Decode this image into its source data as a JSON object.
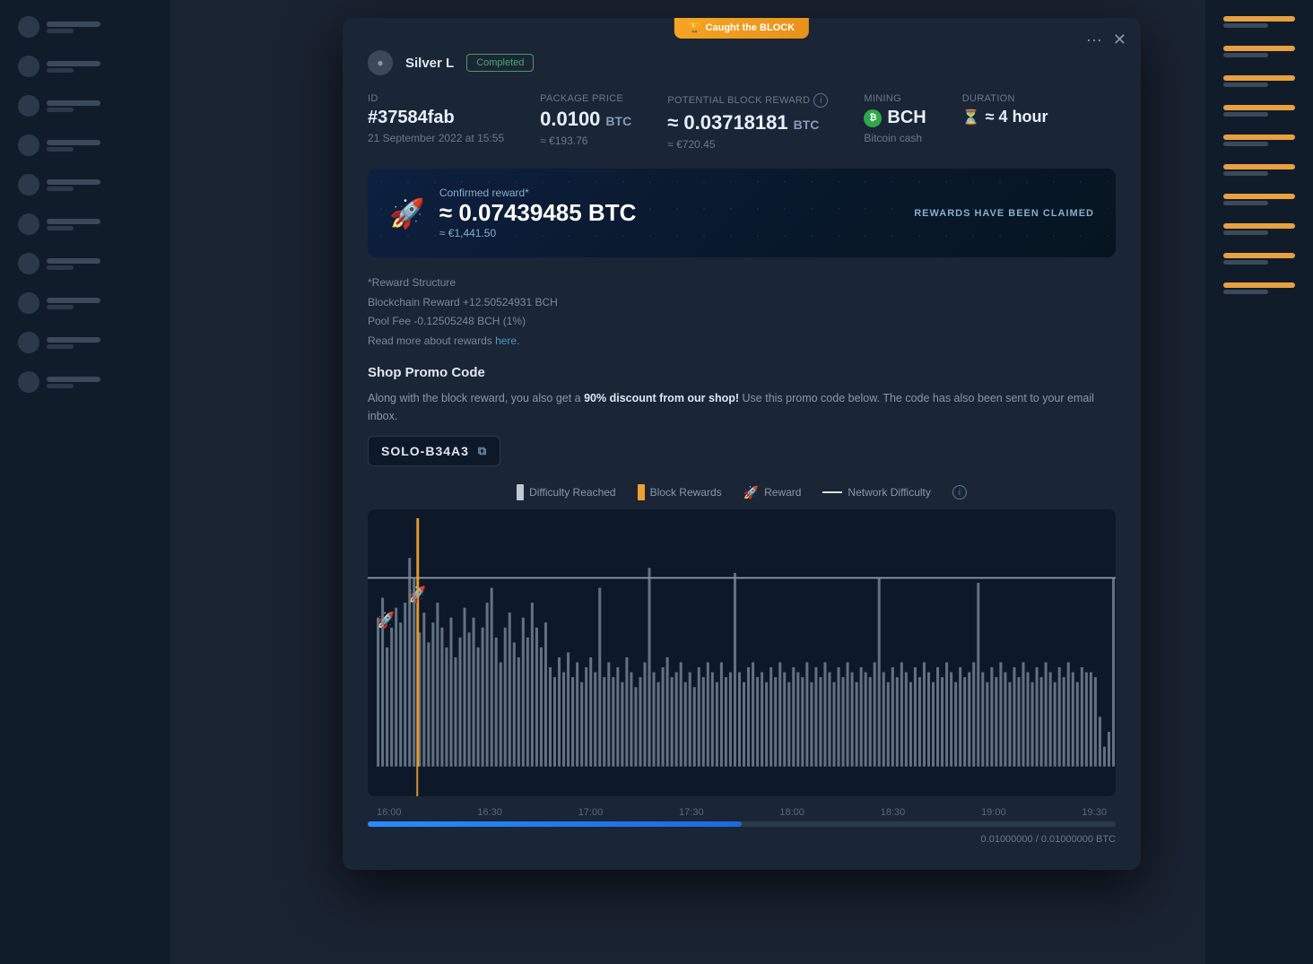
{
  "badge": {
    "icon": "🏆",
    "text": "Caught the BLOCK"
  },
  "modal": {
    "user": {
      "name": "Silver L",
      "status": "Completed"
    },
    "id_label": "ID",
    "id_value": "#37584fab",
    "id_date": "21 September 2022 at 15:55",
    "package_label": "Package Price",
    "package_value": "0.0100",
    "package_unit": "BTC",
    "package_sub": "≈ €193.76",
    "reward_label": "Potential Block Reward",
    "reward_value": "≈ 0.03718181",
    "reward_unit": "BTC",
    "reward_sub": "≈ €720.45",
    "mining_label": "Mining",
    "mining_coin": "BCH",
    "mining_name": "Bitcoin cash",
    "duration_label": "Duration",
    "duration_value": "≈ 4 hour",
    "confirmed_label": "Confirmed reward*",
    "confirmed_value": "≈ 0.07439485 BTC",
    "confirmed_sub": "≈ €1,441.50",
    "claimed_text": "REWARDS HAVE BEEN CLAIMED",
    "reward_structure_title": "*Reward Structure",
    "reward_structure_line1": "Blockchain Reward +12.50524931 BCH",
    "reward_structure_line2": "Pool Fee -0.12505248 BCH (1%)",
    "read_more_prefix": "Read more about rewards ",
    "read_more_link": "here",
    "promo_title": "Shop Promo Code",
    "promo_desc_1": "Along with the block reward, you also get a ",
    "promo_highlight": "90% discount from our shop!",
    "promo_desc_2": " Use this promo code below. The code has also been sent to your email inbox.",
    "promo_code": "SOLO-B34A3"
  },
  "chart": {
    "legend": {
      "difficulty_reached": "Difficulty Reached",
      "block_rewards": "Block Rewards",
      "reward": "Reward",
      "network_difficulty": "Network Difficulty"
    },
    "time_labels": [
      "16:00",
      "16:30",
      "17:00",
      "17:30",
      "18:00",
      "18:30",
      "19:00",
      "19:30"
    ],
    "progress_text": "0.01000000 / 0.01000000 BTC"
  }
}
